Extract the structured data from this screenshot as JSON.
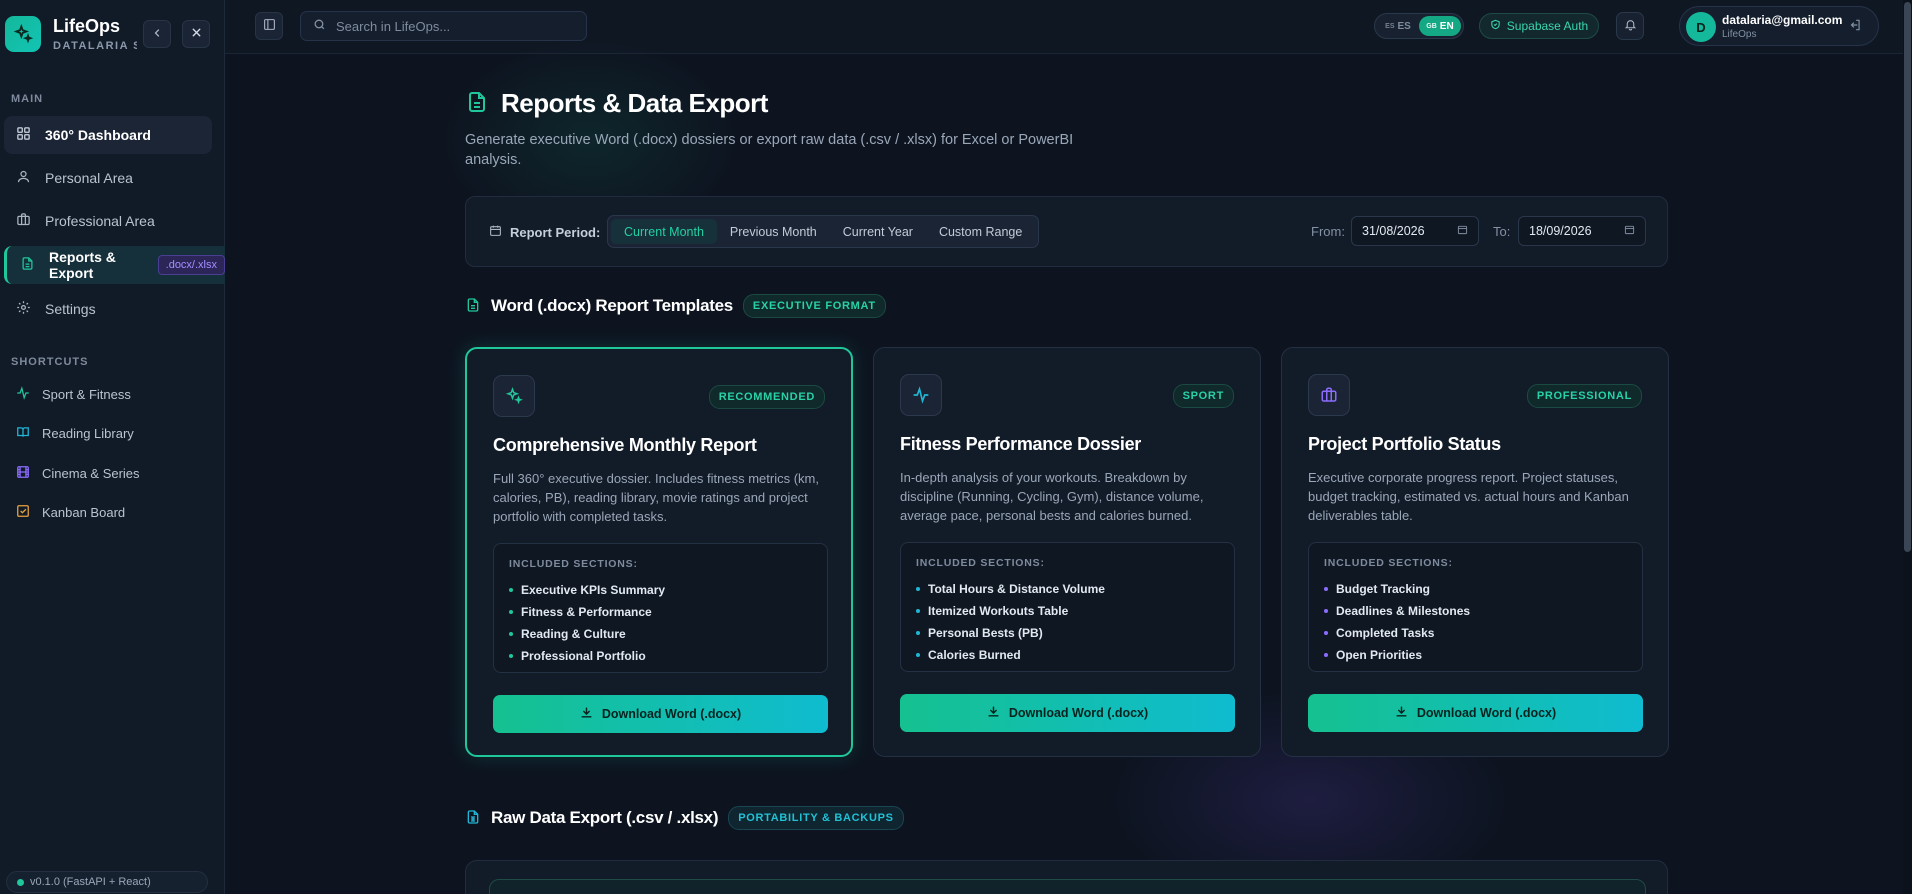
{
  "brand": {
    "name": "LifeOps",
    "subtitle": "DATALARIA ST"
  },
  "sidebar": {
    "main_label": "MAIN",
    "items": [
      {
        "label": "360° Dashboard",
        "icon": "grid-icon"
      },
      {
        "label": "Personal Area",
        "icon": "user-icon"
      },
      {
        "label": "Professional Area",
        "icon": "briefcase-icon"
      },
      {
        "label": "Reports & Export",
        "icon": "document-icon",
        "badge": ".docx/.xlsx"
      },
      {
        "label": "Settings",
        "icon": "gear-icon"
      }
    ],
    "shortcuts_label": "SHORTCUTS",
    "shortcuts": [
      {
        "label": "Sport & Fitness",
        "icon": "activity-icon",
        "color": "#1fc79b"
      },
      {
        "label": "Reading Library",
        "icon": "book-icon",
        "color": "#20b6d6"
      },
      {
        "label": "Cinema & Series",
        "icon": "film-icon",
        "color": "#8b6cff"
      },
      {
        "label": "Kanban Board",
        "icon": "checkbox-icon",
        "color": "#e6a23c"
      }
    ],
    "version": "v0.1.0 (FastAPI + React)"
  },
  "topbar": {
    "search_placeholder": "Search in LifeOps...",
    "lang_es": "ES",
    "lang_en": "EN",
    "lang_es_flag": "ES",
    "lang_en_flag": "GB",
    "auth_label": "Supabase Auth",
    "user_initial": "D",
    "user_email": "datalaria@gmail.com",
    "user_sub": "LifeOps"
  },
  "page": {
    "title": "Reports & Data Export",
    "description": "Generate executive Word (.docx) dossiers or export raw data (.csv / .xlsx) for Excel or PowerBI analysis."
  },
  "period": {
    "label": "Report Period:",
    "options": [
      "Current Month",
      "Previous Month",
      "Current Year",
      "Custom Range"
    ],
    "selected": "Current Month",
    "from_label": "From:",
    "from_value": "31/08/2026",
    "to_label": "To:",
    "to_value": "18/09/2026"
  },
  "word_section": {
    "title": "Word (.docx) Report Templates",
    "tag": "EXECUTIVE FORMAT"
  },
  "cards": [
    {
      "tag": "RECOMMENDED",
      "icon": "sparkles-icon",
      "title": "Comprehensive Monthly Report",
      "description": "Full 360° executive dossier. Includes fitness metrics (km, calories, PB), reading library, movie ratings and project portfolio with completed tasks.",
      "included_label": "INCLUDED SECTIONS:",
      "sections": [
        "Executive KPIs Summary",
        "Fitness & Performance",
        "Reading & Culture",
        "Professional Portfolio"
      ],
      "bullet_color": "#1fc79b",
      "button": "Download Word (.docx)"
    },
    {
      "tag": "SPORT",
      "icon": "activity-icon",
      "title": "Fitness Performance Dossier",
      "description": "In-depth analysis of your workouts. Breakdown by discipline (Running, Cycling, Gym), distance volume, average pace, personal bests and calories burned.",
      "included_label": "INCLUDED SECTIONS:",
      "sections": [
        "Total Hours & Distance Volume",
        "Itemized Workouts Table",
        "Personal Bests (PB)",
        "Calories Burned"
      ],
      "bullet_color": "#20b6d6",
      "button": "Download Word (.docx)"
    },
    {
      "tag": "PROFESSIONAL",
      "icon": "briefcase-icon",
      "title": "Project Portfolio Status",
      "description": "Executive corporate progress report. Project statuses, budget tracking, estimated vs. actual hours and Kanban deliverables table.",
      "included_label": "INCLUDED SECTIONS:",
      "sections": [
        "Budget Tracking",
        "Deadlines & Milestones",
        "Completed Tasks",
        "Open Priorities"
      ],
      "bullet_color": "#8b6cff",
      "button": "Download Word (.docx)"
    }
  ],
  "raw_section": {
    "title": "Raw Data Export (.csv / .xlsx)",
    "tag": "PORTABILITY & BACKUPS"
  }
}
